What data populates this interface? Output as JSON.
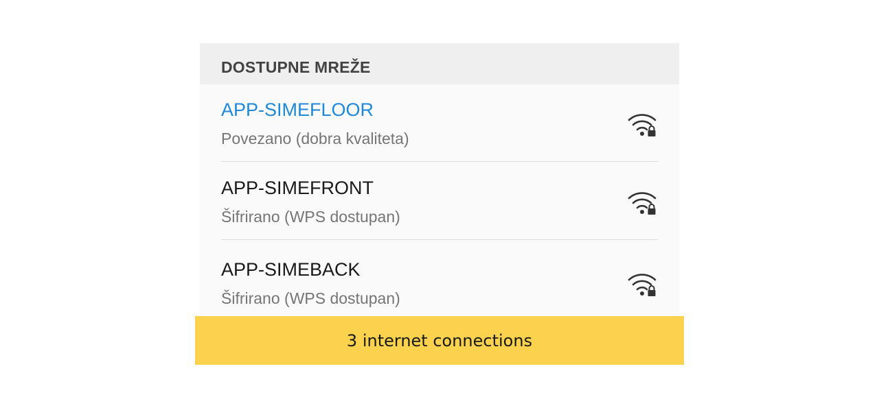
{
  "section": {
    "title": "DOSTUPNE MREŽE"
  },
  "networks": [
    {
      "name": "APP-SIMEFLOOR",
      "status": "Povezano (dobra kvaliteta)",
      "connected": true,
      "icon": "wifi-lock-icon"
    },
    {
      "name": "APP-SIMEFRONT",
      "status": "Šifrirano (WPS dostupan)",
      "connected": false,
      "icon": "wifi-lock-icon"
    },
    {
      "name": "APP-SIMEBACK",
      "status": "Šifrirano (WPS dostupan)",
      "connected": false,
      "icon": "wifi-lock-icon"
    }
  ],
  "banner": {
    "text": "3 internet connections"
  },
  "colors": {
    "connected_name": "#1e88d9",
    "banner_background": "#fbd24e",
    "section_background": "#efefef",
    "list_background": "#fafafa"
  }
}
